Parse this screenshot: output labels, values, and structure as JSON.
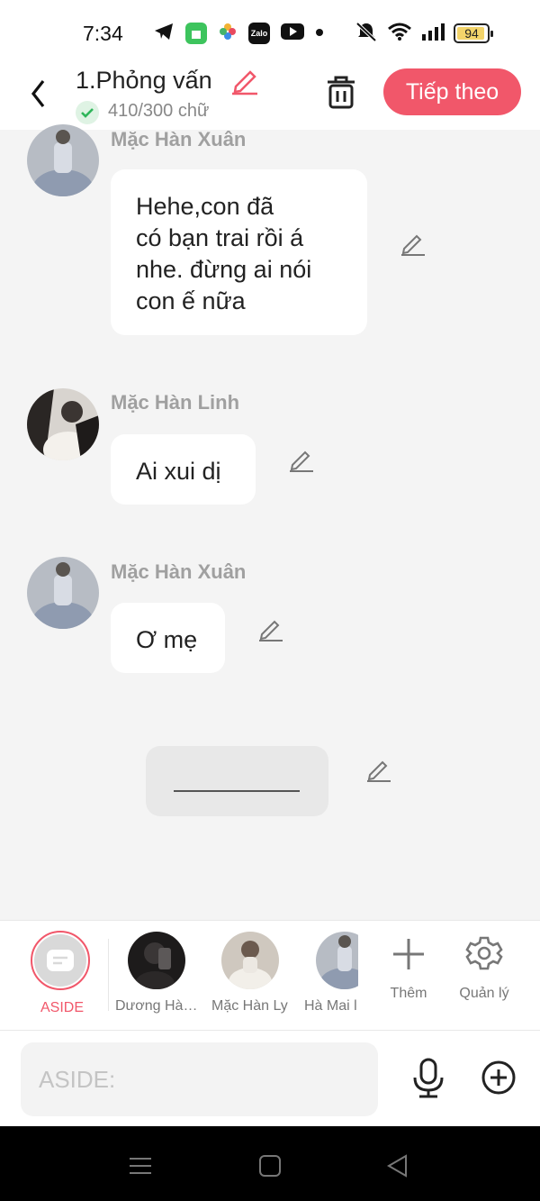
{
  "status": {
    "time": "7:34",
    "battery": "94",
    "zalo_label": "Zalo"
  },
  "header": {
    "title": "1.Phỏng vấn",
    "word_count": "410/300 chữ",
    "next_label": "Tiếp theo"
  },
  "messages": [
    {
      "sender": "Mặc Hàn Xuân",
      "text_lines": [
        "Hehe,con đã",
        "có bạn trai rồi á",
        "nhe. đừng ai nói",
        "con ế nữa"
      ]
    },
    {
      "sender": "Mặc Hàn Linh",
      "text": "Ai xui dị"
    },
    {
      "sender": "Mặc Hàn Xuân",
      "text": "Ơ mẹ"
    }
  ],
  "characters": {
    "aside_label": "ASIDE",
    "items": [
      {
        "name": "Dương Hà…"
      },
      {
        "name": "Mặc Hàn Ly"
      },
      {
        "name": "Hà Mai l"
      }
    ],
    "add_label": "Thêm",
    "manage_label": "Quản lý"
  },
  "input": {
    "placeholder": "ASIDE:"
  },
  "colors": {
    "accent": "#f1576a",
    "background": "#f4f4f4"
  }
}
